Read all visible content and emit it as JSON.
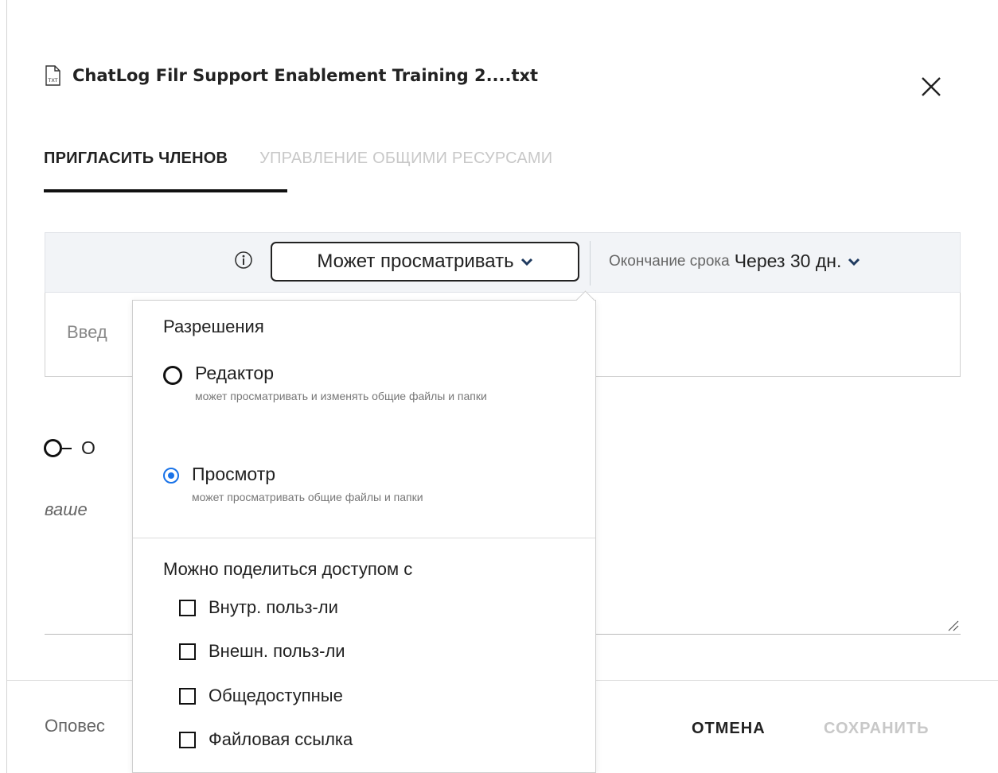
{
  "dialog": {
    "title": "ChatLog Filr Support Enablement Training 2....txt",
    "file_type_icon": "txt-file-icon",
    "close_icon": "close-icon"
  },
  "tabs": [
    {
      "label": "ПРИГЛАСИТЬ ЧЛЕНОВ",
      "active": true
    },
    {
      "label": "УПРАВЛЕНИЕ ОБЩИМИ РЕСУРСАМИ",
      "active": false
    }
  ],
  "permission_bar": {
    "selected_permission": "Может просматривать",
    "expiry_label": "Окончание срока",
    "expiry_value": "Через 30 дн."
  },
  "member_input": {
    "partial_text": "Введ"
  },
  "notify_toggle": {
    "partial_text": "О"
  },
  "message": {
    "partial_hint": "ваше"
  },
  "dropdown": {
    "permissions_heading": "Разрешения",
    "options": [
      {
        "label": "Редактор",
        "description": "может просматривать и изменять общие файлы и папки",
        "selected": false
      },
      {
        "label": "Просмотр",
        "description": "может просматривать общие файлы и папки",
        "selected": true
      }
    ],
    "share_heading": "Можно поделиться доступом с",
    "share_options": [
      {
        "label": "Внутр. польз-ли",
        "checked": false
      },
      {
        "label": "Внешн. польз-ли",
        "checked": false
      },
      {
        "label": "Общедоступные",
        "checked": false
      },
      {
        "label": "Файловая ссылка",
        "checked": false
      }
    ]
  },
  "footer": {
    "notify_partial": "Оповес",
    "cancel_label": "ОТМЕНА",
    "save_label": "СОХРАНИТЬ"
  },
  "colors": {
    "accent_radio": "#1a73e8",
    "chevron": "#1f3a5f",
    "disabled_text": "#c8c8c8",
    "bar_background": "#f2f4f7"
  }
}
